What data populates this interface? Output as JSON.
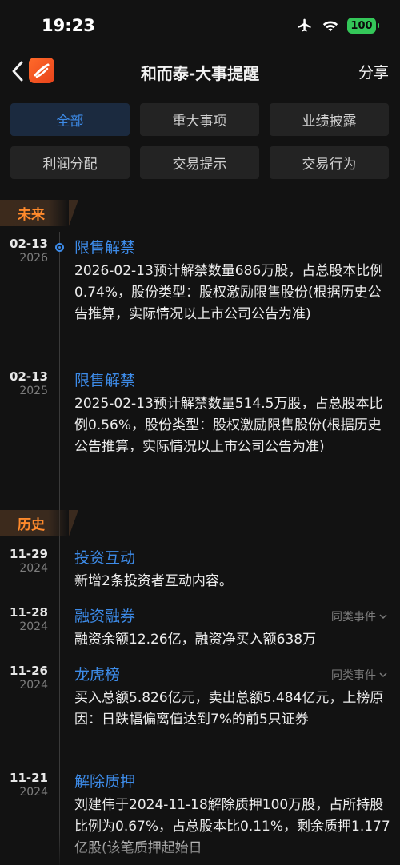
{
  "status_bar": {
    "time": "19:23",
    "battery": "100"
  },
  "nav": {
    "title": "和而泰-大事提醒",
    "share_label": "分享"
  },
  "filters": [
    {
      "label": "全部",
      "active": true
    },
    {
      "label": "重大事项"
    },
    {
      "label": "业绩披露"
    },
    {
      "label": "利润分配"
    },
    {
      "label": "交易提示"
    },
    {
      "label": "交易行为"
    }
  ],
  "sections": {
    "future": "未来",
    "history": "历史"
  },
  "similar_label": "同类事件",
  "events": [
    {
      "date": "02-13",
      "year": "2026",
      "title": "限售解禁",
      "body": "2026-02-13预计解禁数量686万股，占总股本比例0.74%，股份类型：股权激励限售股份(根据历史公告推算，实际情况以上市公司公告为准)"
    },
    {
      "date": "02-13",
      "year": "2025",
      "title": "限售解禁",
      "body": "2025-02-13预计解禁数量514.5万股，占总股本比例0.56%，股份类型：股权激励限售股份(根据历史公告推算，实际情况以上市公司公告为准)"
    },
    {
      "date": "11-29",
      "year": "2024",
      "title": "投资互动",
      "body": "新增2条投资者互动内容。"
    },
    {
      "date": "11-28",
      "year": "2024",
      "title": "融资融券",
      "body": "融资余额12.26亿，融资净买入额638万"
    },
    {
      "date": "11-26",
      "year": "2024",
      "title": "龙虎榜",
      "body": "买入总额5.826亿元，卖出总额5.484亿元，上榜原因：日跌幅偏离值达到7%的前5只证券"
    },
    {
      "date": "11-21",
      "year": "2024",
      "title": "解除质押",
      "body": "刘建伟于2024-11-18解除质押100万股，占所持股比例为0.67%，占总股本比0.11%，剩余质押1.177亿股(该笔质押起始日"
    }
  ],
  "colors": {
    "accent": "#3d8be8",
    "tag": "#ff8a2c",
    "background": "#121212"
  },
  "icons": [
    "airplane-icon",
    "wifi-icon",
    "battery-icon",
    "back-chevron-icon",
    "app-logo-icon",
    "chevron-down-icon"
  ]
}
